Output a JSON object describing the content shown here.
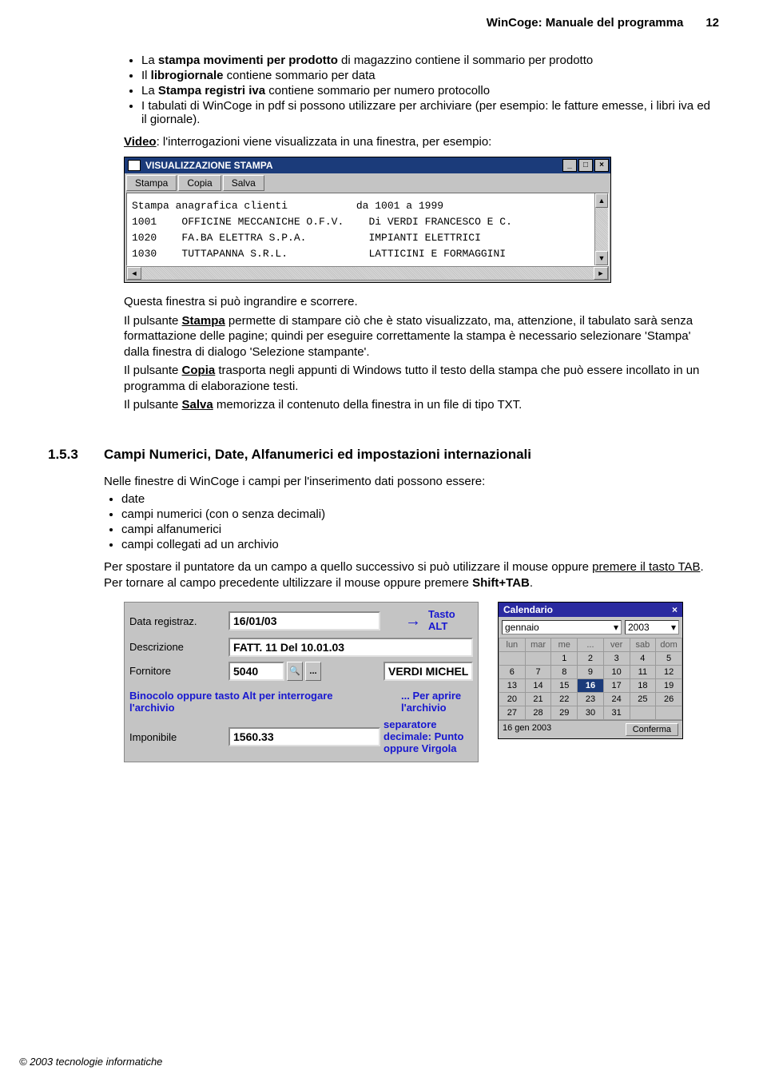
{
  "header": {
    "title": "WinCoge: Manuale del programma",
    "page": "12"
  },
  "bullets_top": [
    {
      "pre": "La ",
      "bold": "stampa movimenti per prodotto",
      "post": " di magazzino contiene il sommario per prodotto"
    },
    {
      "pre": "Il ",
      "bold": "librogiornale",
      "post": " contiene sommario per data"
    },
    {
      "pre": "La ",
      "bold": "Stampa registri iva",
      "post": " contiene sommario per numero protocollo"
    },
    {
      "pre": "I tabulati di WinCoge in pdf si possono utilizzare per archiviare (per esempio: le fatture emesse, i libri iva ed il giornale).",
      "bold": "",
      "post": ""
    }
  ],
  "video_line_label": "Video",
  "video_line_rest": ": l'interrogazioni viene visualizzata in una finestra, per esempio:",
  "win1": {
    "title": "VISUALIZZAZIONE STAMPA",
    "buttons": [
      "Stampa",
      "Copia",
      "Salva"
    ],
    "line1": "Stampa anagrafica clienti           da 1001 a 1999",
    "rows": [
      {
        "c": "1001",
        "n": "OFFICINE MECCANICHE O.F.V.",
        "d": "Di VERDI FRANCESCO E C."
      },
      {
        "c": "1020",
        "n": "FA.BA ELETTRA S.P.A.",
        "d": "IMPIANTI ELETTRICI"
      },
      {
        "c": "1030",
        "n": "TUTTAPANNA S.R.L.",
        "d": "LATTICINI E FORMAGGINI"
      }
    ]
  },
  "para1_l1": "Questa finestra si può ingrandire e scorrere.",
  "para1_l2a": "Il pulsante ",
  "para1_l2b": "Stampa",
  "para1_l2c": " permette di stampare ciò che è stato visualizzato, ma, attenzione, il tabulato sarà senza formattazione delle pagine; quindi per eseguire correttamente la stampa è necessario selezionare 'Stampa' dalla finestra di dialogo 'Selezione stampante'.",
  "para1_l3a": "Il pulsante ",
  "para1_l3b": "Copia",
  "para1_l3c": " trasporta negli appunti di Windows tutto il testo della stampa che può essere incollato in un programma di elaborazione testi.",
  "para1_l4a": "Il pulsante ",
  "para1_l4b": "Salva",
  "para1_l4c": " memorizza il contenuto della finestra in un file di tipo TXT.",
  "section": {
    "num": "1.5.3",
    "title": "Campi Numerici, Date, Alfanumerici ed impostazioni internazionali"
  },
  "para2_intro": "Nelle finestre di WinCoge i campi per l'inserimento dati possono essere:",
  "bullets2": [
    "date",
    "campi numerici (con o senza decimali)",
    "campi alfanumerici",
    "campi collegati ad un archivio"
  ],
  "para2_a": "Per spostare il puntatore da un campo a quello successivo si può utilizzare il mouse oppure ",
  "para2_b": "premere il tasto TAB",
  "para2_c": ". Per tornare al campo precedente ultilizzare il mouse oppure premere ",
  "para2_d": "Shift+TAB",
  "para2_e": ".",
  "form": {
    "data_lbl": "Data registraz.",
    "data_val": "16/01/03",
    "descr_lbl": "Descrizione",
    "descr_val": "FATT. 11 Del 10.01.03",
    "forn_lbl": "Fornitore",
    "forn_val": "5040",
    "forn_name": "VERDI MICHELE",
    "imp_lbl": "Imponibile",
    "imp_val": "1560.33",
    "note_tasto_alt": "Tasto ALT",
    "note_binocolo": "Binocolo oppure tasto Alt per interrogare l'archivio",
    "note_aprire": "... Per aprire l'archivio",
    "note_sep": "separatore decimale: Punto oppure Virgola",
    "dots_btn": "..."
  },
  "calendar": {
    "title": "Calendario",
    "month": "gennaio",
    "year": "2003",
    "dow": [
      "lun",
      "mar",
      "me",
      "...",
      "ver",
      "sab",
      "dom"
    ],
    "weeks": [
      [
        "",
        "",
        "1",
        "2",
        "3",
        "4",
        "5"
      ],
      [
        "6",
        "7",
        "8",
        "9",
        "10",
        "11",
        "12"
      ],
      [
        "13",
        "14",
        "15",
        "16",
        "17",
        "18",
        "19"
      ],
      [
        "20",
        "21",
        "22",
        "23",
        "24",
        "25",
        "26"
      ],
      [
        "27",
        "28",
        "29",
        "30",
        "31",
        "",
        ""
      ]
    ],
    "selected": "16",
    "footer_date": "16 gen 2003",
    "footer_btn": "Conferma"
  },
  "footer": "© 2003 tecnologie informatiche"
}
